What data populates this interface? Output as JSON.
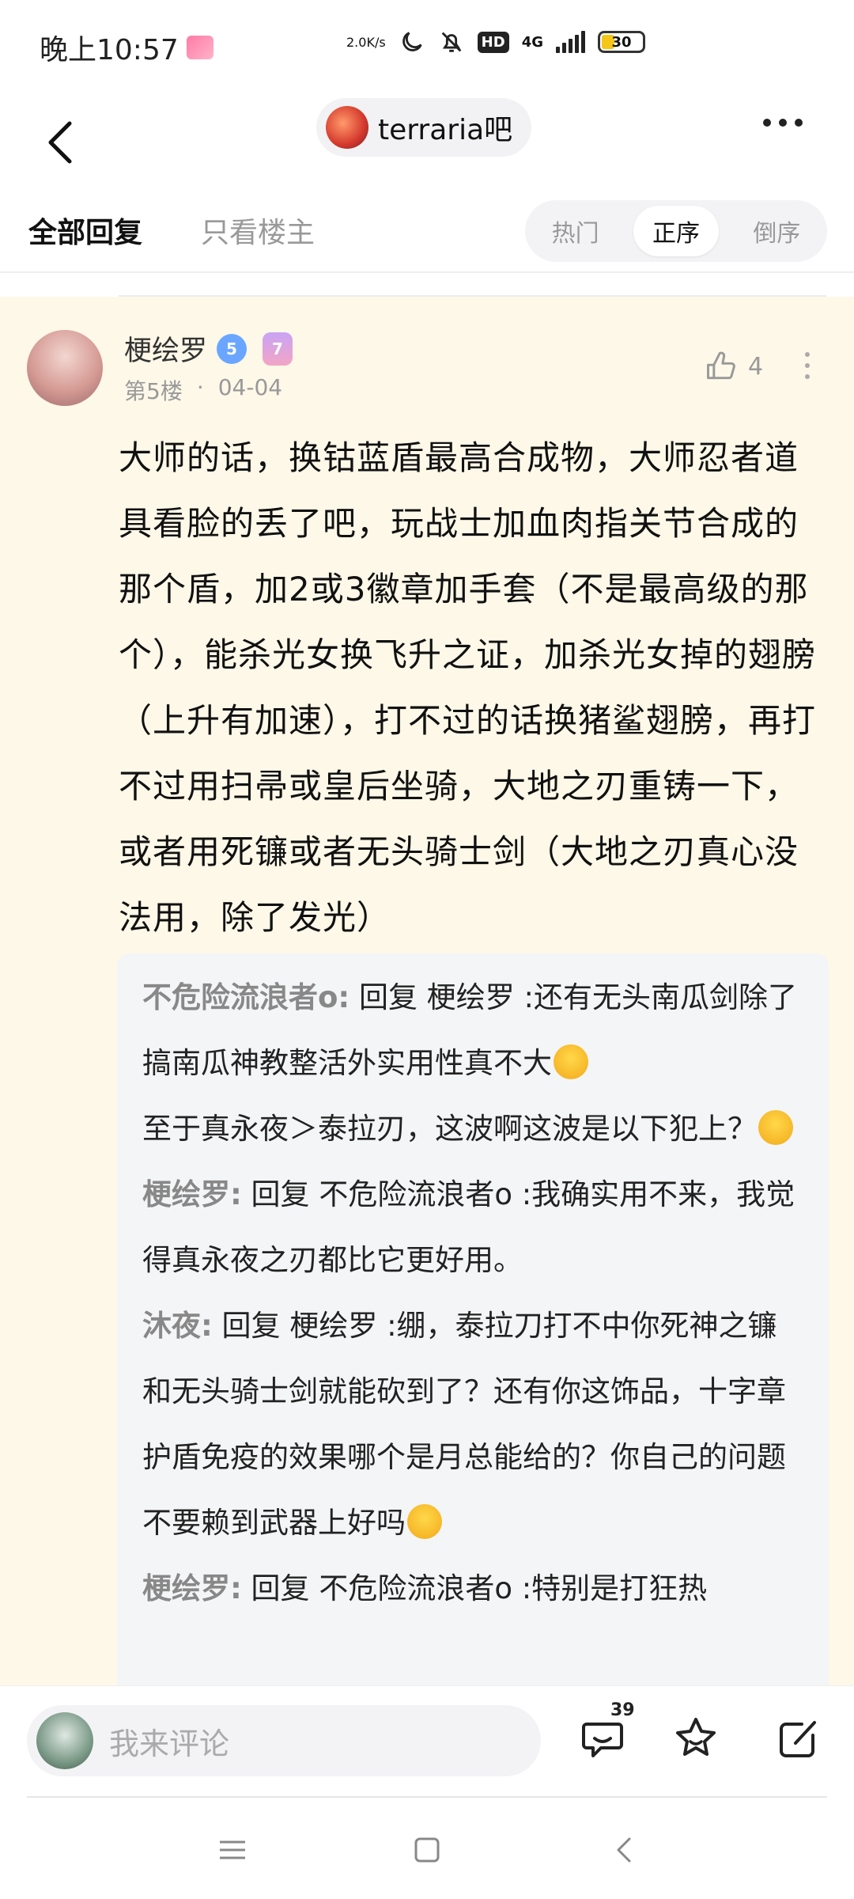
{
  "status_bar": {
    "time": "晚上10:57",
    "net_speed": "2.0K/s",
    "hd": "HD",
    "network": "4G",
    "battery": "30"
  },
  "nav": {
    "forum_name": "terraria吧"
  },
  "tabs": {
    "all": "全部回复",
    "op_only": "只看楼主",
    "sort_options": [
      "热门",
      "正序",
      "倒序"
    ],
    "sort_active": "正序"
  },
  "post": {
    "author": "梗绘罗",
    "level": "5",
    "badge": "7",
    "floor": "第5楼",
    "separator": "·",
    "date": "04-04",
    "likes": "4",
    "body": "大师的话，换钴蓝盾最高合成物，大师忍者道具看脸的丢了吧，玩战士加血肉指关节合成的那个盾，加2或3徽章加手套（不是最高级的那个），能杀光女换飞升之证，加杀光女掉的翅膀（上升有加速），打不过的话换猪鲨翅膀，再打不过用扫帚或皇后坐骑，大地之刃重铸一下，或者用死镰或者无头骑士剑（大地之刃真心没法用，除了发光）"
  },
  "sub_replies": [
    {
      "who": "不危险流浪者o:",
      "text": " 回复 梗绘罗 :还有无头南瓜剑除了搞南瓜神教整活外实用性真不大",
      "emoji": "grin-emoji",
      "tail": "至于真永夜＞泰拉刃，这波啊这波是以下犯上？",
      "emoji2": "thinking-emoji"
    },
    {
      "who": "梗绘罗:",
      "text": " 回复 不危险流浪者o :我确实用不来，我觉得真永夜之刃都比它更好用。"
    },
    {
      "who": "沐夜:",
      "text": " 回复 梗绘罗 :绷，泰拉刀打不中你死神之镰和无头骑士剑就能砍到了？还有你这饰品，十字章护盾免疫的效果哪个是月总能给的？你自己的问题不要赖到武器上好吗",
      "emoji": "smirk-emoji"
    },
    {
      "who": "梗绘罗:",
      "text": " 回复 不危险流浪者o :特别是打狂热"
    }
  ],
  "bottom": {
    "comment_placeholder": "我来评论",
    "comment_count": "39"
  },
  "colors": {
    "post_background": "#fdf8e8",
    "sub_reply_background": "#f4f5f7",
    "accent_blue": "#6aa6ff"
  }
}
